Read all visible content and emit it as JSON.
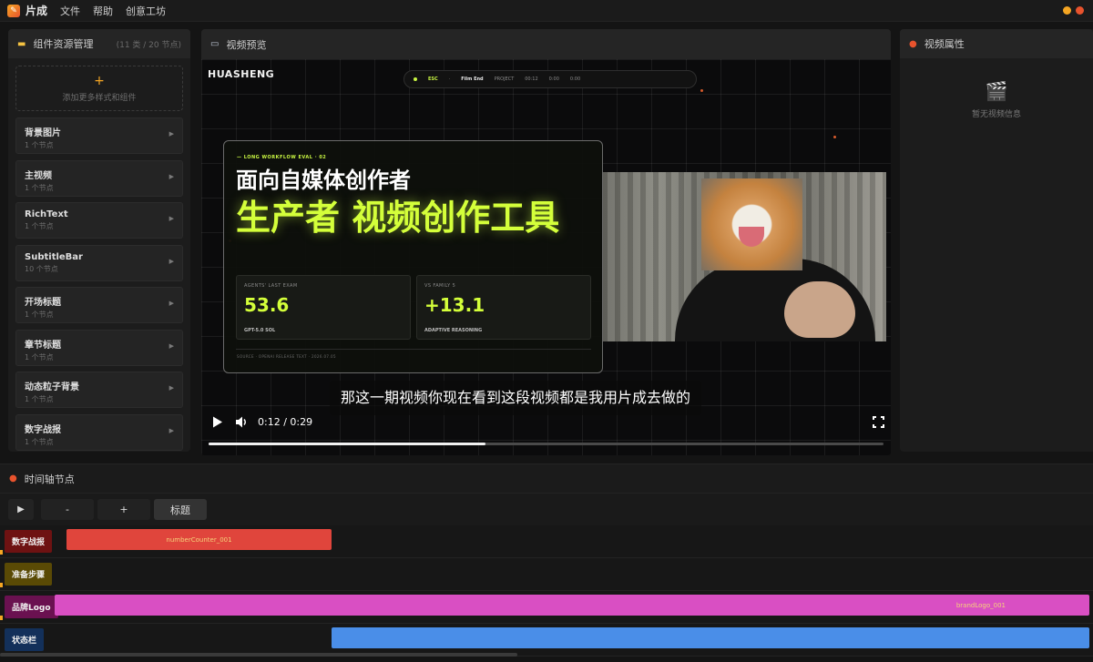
{
  "app": {
    "name": "片成",
    "logo_glyph": "✎",
    "accent": "#f5a623"
  },
  "menu": [
    {
      "label": "文件"
    },
    {
      "label": "帮助"
    },
    {
      "label": "创意工坊"
    }
  ],
  "window_dots": [
    "#f5a623",
    "#e8532d"
  ],
  "left_panel": {
    "icon": "folder-icon",
    "title": "组件资源管理",
    "count": "(11 类 / 20 节点)",
    "add_plus": "+",
    "add_text": "添加更多样式和组件",
    "items": [
      {
        "name": "背景图片",
        "sub": "1 个节点"
      },
      {
        "name": "主视频",
        "sub": "1 个节点"
      },
      {
        "name": "RichText",
        "sub": "1 个节点"
      },
      {
        "name": "SubtitleBar",
        "sub": "10 个节点"
      },
      {
        "name": "开场标题",
        "sub": "1 个节点"
      },
      {
        "name": "章节标题",
        "sub": "1 个节点"
      },
      {
        "name": "动态粒子背景",
        "sub": "1 个节点"
      },
      {
        "name": "数字战报",
        "sub": "1 个节点"
      }
    ]
  },
  "preview": {
    "icon": "film-icon",
    "title": "视频预览",
    "brand": "HUASHENG",
    "top_pill": [
      "ESC",
      "·",
      "Film End",
      "PROJECT",
      "00:12",
      "0:00",
      "0:00"
    ],
    "card": {
      "kicker": "— LONG WORKFLOW EVAL · 02",
      "headline": "面向自媒体创作者",
      "headline2": "生产者 视频创作工具",
      "stats": [
        {
          "label": "AGENTS' LAST EXAM",
          "value": "53.6",
          "caption": "GPT-5.0 SOL"
        },
        {
          "label": "VS FAMILY 5",
          "value": "+13.1",
          "caption": "ADAPTIVE REASONING"
        }
      ],
      "footer": "SOURCE · OPENAI RELEASE TEXT · 2026.07.05"
    },
    "subtitle": "那这一期视频你现在看到这段视频都是我用片成去做的",
    "time": "0:12 / 0:29",
    "progress": 0.41
  },
  "right_panel": {
    "icon": "pin-icon",
    "title": "视频属性",
    "empty_icon": "🎬",
    "empty_text": "暂无视频信息"
  },
  "timeline": {
    "icon": "pin-icon",
    "title": "时间轴节点",
    "buttons": {
      "play": "▶",
      "minus": "-",
      "plus": "+",
      "title": "标题"
    },
    "tracks": [
      {
        "label": "数字战报",
        "label_color": "#6e1212",
        "clip_text": "numberCounter_001",
        "clip_color": "#e0453c",
        "clip_text_color": "#f5d27a"
      },
      {
        "label": "准备步骤",
        "label_color": "#5a4a05",
        "clip_text": "",
        "clip_color": "",
        "clip_text_color": ""
      },
      {
        "label": "品牌Logo",
        "label_color": "#6a1150",
        "clip_text": "brandLogo_001",
        "clip_color": "#d94fc3",
        "clip_text_color": "#f5d27a"
      },
      {
        "label": "状态栏",
        "label_color": "#13305a",
        "clip_text": "",
        "clip_color": "#4a8ee8",
        "clip_text_color": ""
      }
    ]
  }
}
